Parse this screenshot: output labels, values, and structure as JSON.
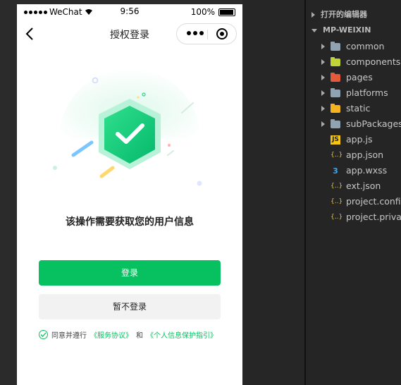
{
  "status_bar": {
    "carrier": "WeChat",
    "time": "9:56",
    "battery": "100%"
  },
  "nav": {
    "title": "授权登录"
  },
  "main": {
    "message": "该操作需要获取您的用户信息",
    "login_label": "登录",
    "skip_label": "暂不登录"
  },
  "agreement": {
    "prefix": "同意并遵行",
    "service": "《服务协议》",
    "and": "和",
    "privacy": "《个人信息保护指引》"
  },
  "colors": {
    "accent": "#07c160",
    "editor_bg": "#252525"
  },
  "explorer": {
    "open_editors": "打开的编辑器",
    "project": "MP-WEIXIN",
    "items": [
      {
        "label": "common",
        "icon": "folder-icon"
      },
      {
        "label": "components",
        "icon": "components-folder-icon"
      },
      {
        "label": "pages",
        "icon": "pages-folder-icon"
      },
      {
        "label": "platforms",
        "icon": "folder-icon"
      },
      {
        "label": "static",
        "icon": "static-folder-icon"
      },
      {
        "label": "subPackages",
        "icon": "folder-icon"
      },
      {
        "label": "app.js",
        "icon": "js-file-icon"
      },
      {
        "label": "app.json",
        "icon": "json-file-icon"
      },
      {
        "label": "app.wxss",
        "icon": "css-file-icon"
      },
      {
        "label": "ext.json",
        "icon": "json-file-icon"
      },
      {
        "label": "project.config",
        "icon": "json-file-icon"
      },
      {
        "label": "project.private",
        "icon": "json-file-icon"
      }
    ]
  }
}
